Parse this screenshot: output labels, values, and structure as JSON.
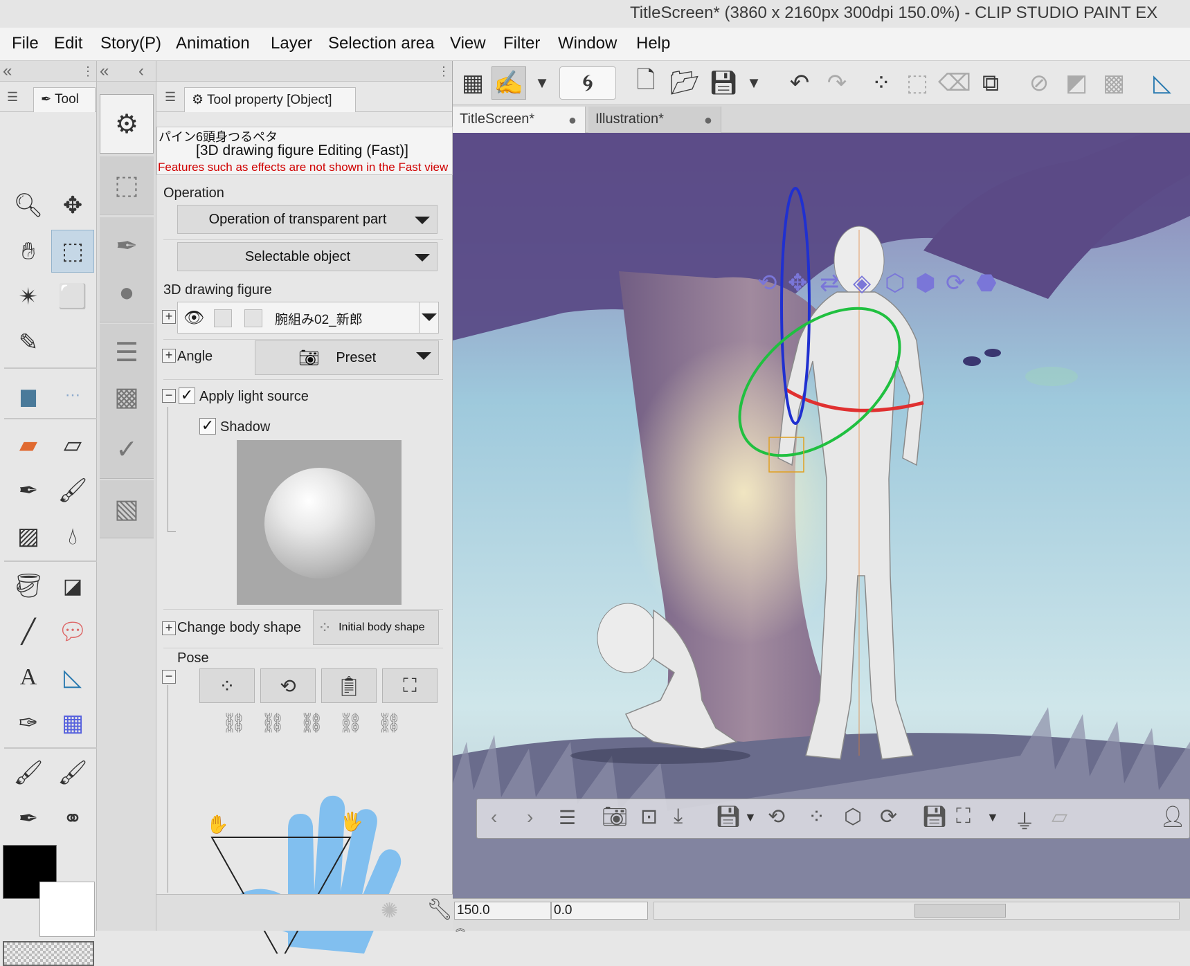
{
  "window": {
    "title": "TitleScreen* (3860 x 2160px 300dpi 150.0%)  - CLIP STUDIO PAINT EX"
  },
  "menu": [
    "File",
    "Edit",
    "Story(P)",
    "Animation",
    "Layer",
    "Selection area",
    "View",
    "Filter",
    "Window",
    "Help"
  ],
  "tool_panel": {
    "tab_label": "Tool"
  },
  "tool_property": {
    "tab_label": "Tool property [Object]",
    "subtool_name": "パイン6頭身つるペタ",
    "mode_title": "[3D drawing figure Editing (Fast)]",
    "warning": "Features such as effects are not shown in the Fast view",
    "operation_label": "Operation",
    "operation_dropdown": "Operation of transparent part",
    "selectable_dropdown": "Selectable object",
    "figure_label": "3D drawing figure",
    "figure_name": "腕組み02_新郎",
    "angle_label": "Angle",
    "preset_label": "Preset",
    "apply_light_label": "Apply light source",
    "shadow_label": "Shadow",
    "change_body_label": "Change body shape",
    "initial_body_label": "Initial body shape",
    "pose_label": "Pose"
  },
  "documents": [
    {
      "label": "TitleScreen*",
      "active": true
    },
    {
      "label": "Illustration*",
      "active": false
    }
  ],
  "status": {
    "zoom": "150.0",
    "rotation": "0.0"
  },
  "colors": {
    "main": "#000000",
    "sub": "#ffffff",
    "accent_selection": "#c5d7e6",
    "warning": "#d00000"
  }
}
